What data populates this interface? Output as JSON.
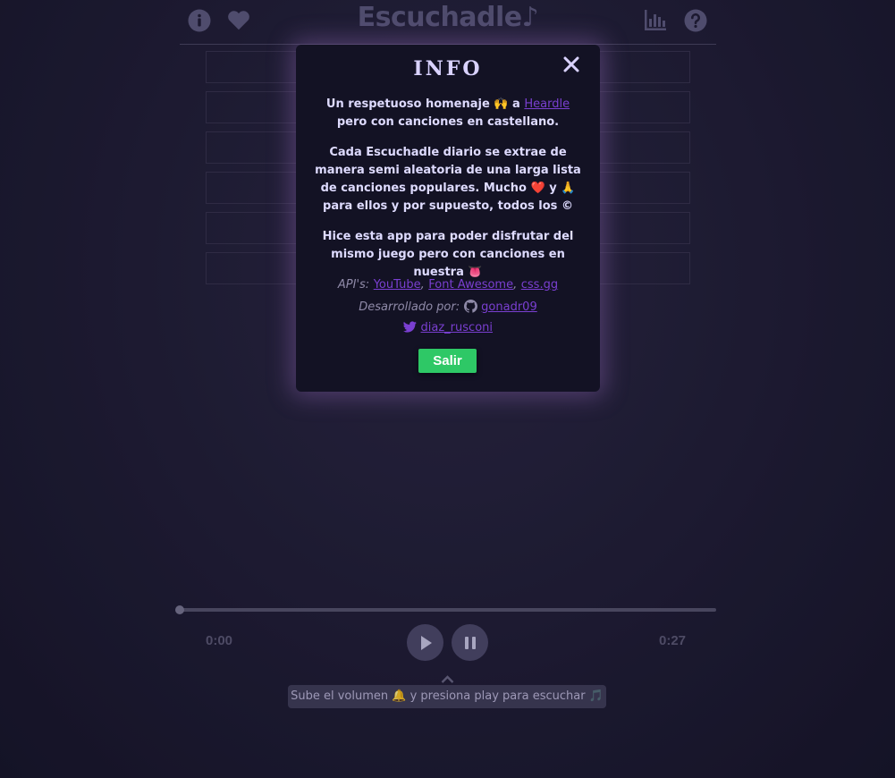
{
  "header": {
    "title": "Escuchadle",
    "title_note_glyph": "♪",
    "icons": [
      "info-icon",
      "heart-icon",
      "stats-icon",
      "help-icon"
    ]
  },
  "modal": {
    "title": "INFO",
    "p1_a": "Un respetuoso homenaje",
    "p1_emoji": "🙌",
    "p1_b": "a",
    "p1_link": "Heardle",
    "p1_c": "pero con canciones en castellano.",
    "p2_a": "Cada Escuchadle diario se extrae de manera semi aleatoria de una larga lista de canciones populares. Mucho",
    "p2_heart": "❤️",
    "p2_b": "y",
    "p2_pray": "🙏",
    "p2_c": "para ellos y por supuesto, todos los",
    "p2_copy": "©",
    "p3_a": "Hice esta app para poder disfrutar del mismo juego pero con canciones en nuestra",
    "p3_emoji": "👅",
    "apis_label": "API's:",
    "apis": [
      "YouTube",
      "Font Awesome",
      "css.gg"
    ],
    "dev_label": "Desarrollado por:",
    "github_user": "gonadr09",
    "twitter_user": "diaz_rusconi",
    "exit_button": "Salir"
  },
  "player": {
    "current_time": "0:00",
    "total_time": "0:27",
    "progress": 0,
    "hint_a": "Sube el volumen",
    "hint_bell": "🔔",
    "hint_b": "y presiona play para escuchar",
    "hint_note": "🎵"
  },
  "colors": {
    "accent_link": "#7a3fd1",
    "exit_button": "#2ec866",
    "background": "#201d36"
  }
}
